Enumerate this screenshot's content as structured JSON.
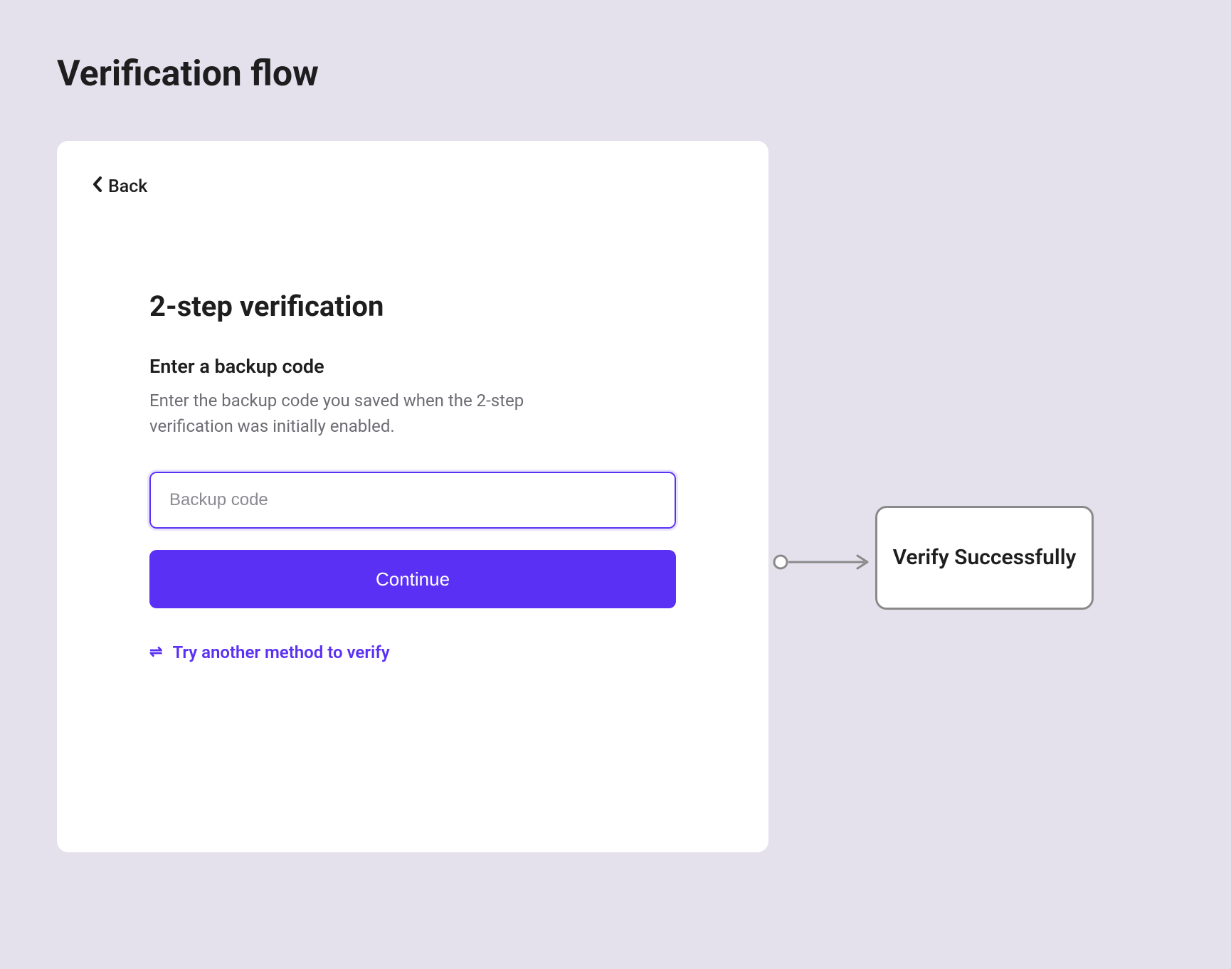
{
  "page": {
    "title": "Verification flow"
  },
  "card": {
    "back_label": "Back",
    "heading": "2-step verification",
    "subheading": "Enter a backup code",
    "description": "Enter the backup code you saved when the 2-step verification was initially enabled.",
    "input": {
      "placeholder": "Backup code",
      "value": ""
    },
    "continue_label": "Continue",
    "alt_method_label": "Try another method to verify"
  },
  "diagram": {
    "result_label": "Verify Successfully"
  }
}
